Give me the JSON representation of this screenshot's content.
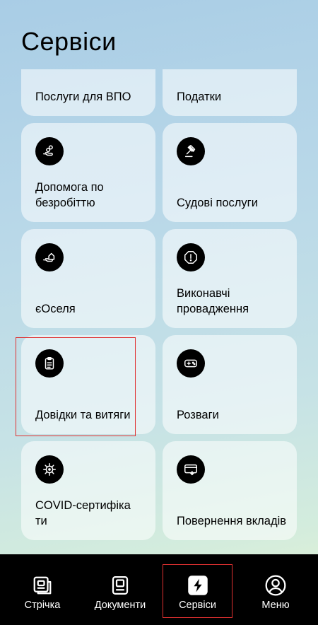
{
  "page": {
    "title": "Сервіси"
  },
  "cards": [
    {
      "label": "Послуги для ВПО",
      "icon": "idp-icon"
    },
    {
      "label": "Податки",
      "icon": "taxes-icon"
    },
    {
      "label": "Допомога по безробіттю",
      "icon": "hand-coins-icon"
    },
    {
      "label": "Судові послуги",
      "icon": "gavel-icon"
    },
    {
      "label": "єОселя",
      "icon": "hand-house-icon"
    },
    {
      "label": "Виконавчі провадження",
      "icon": "exclamation-octagon-icon"
    },
    {
      "label": "Довідки та витяги",
      "icon": "clipboard-icon"
    },
    {
      "label": "Розваги",
      "icon": "gamepad-icon"
    },
    {
      "label": "COVID-сертифіка ти",
      "icon": "virus-icon"
    },
    {
      "label": "Повернення вкладів",
      "icon": "card-return-icon"
    }
  ],
  "nav": [
    {
      "label": "Стрічка",
      "icon": "feed-icon"
    },
    {
      "label": "Документи",
      "icon": "documents-icon"
    },
    {
      "label": "Сервіси",
      "icon": "lightning-icon",
      "active": true
    },
    {
      "label": "Меню",
      "icon": "profile-icon"
    }
  ],
  "colors": {
    "icon_bg": "#000000",
    "card_bg": "rgba(255,255,255,0.55)",
    "nav_bg": "#000000",
    "active_nav_bg": "#ffffff"
  }
}
